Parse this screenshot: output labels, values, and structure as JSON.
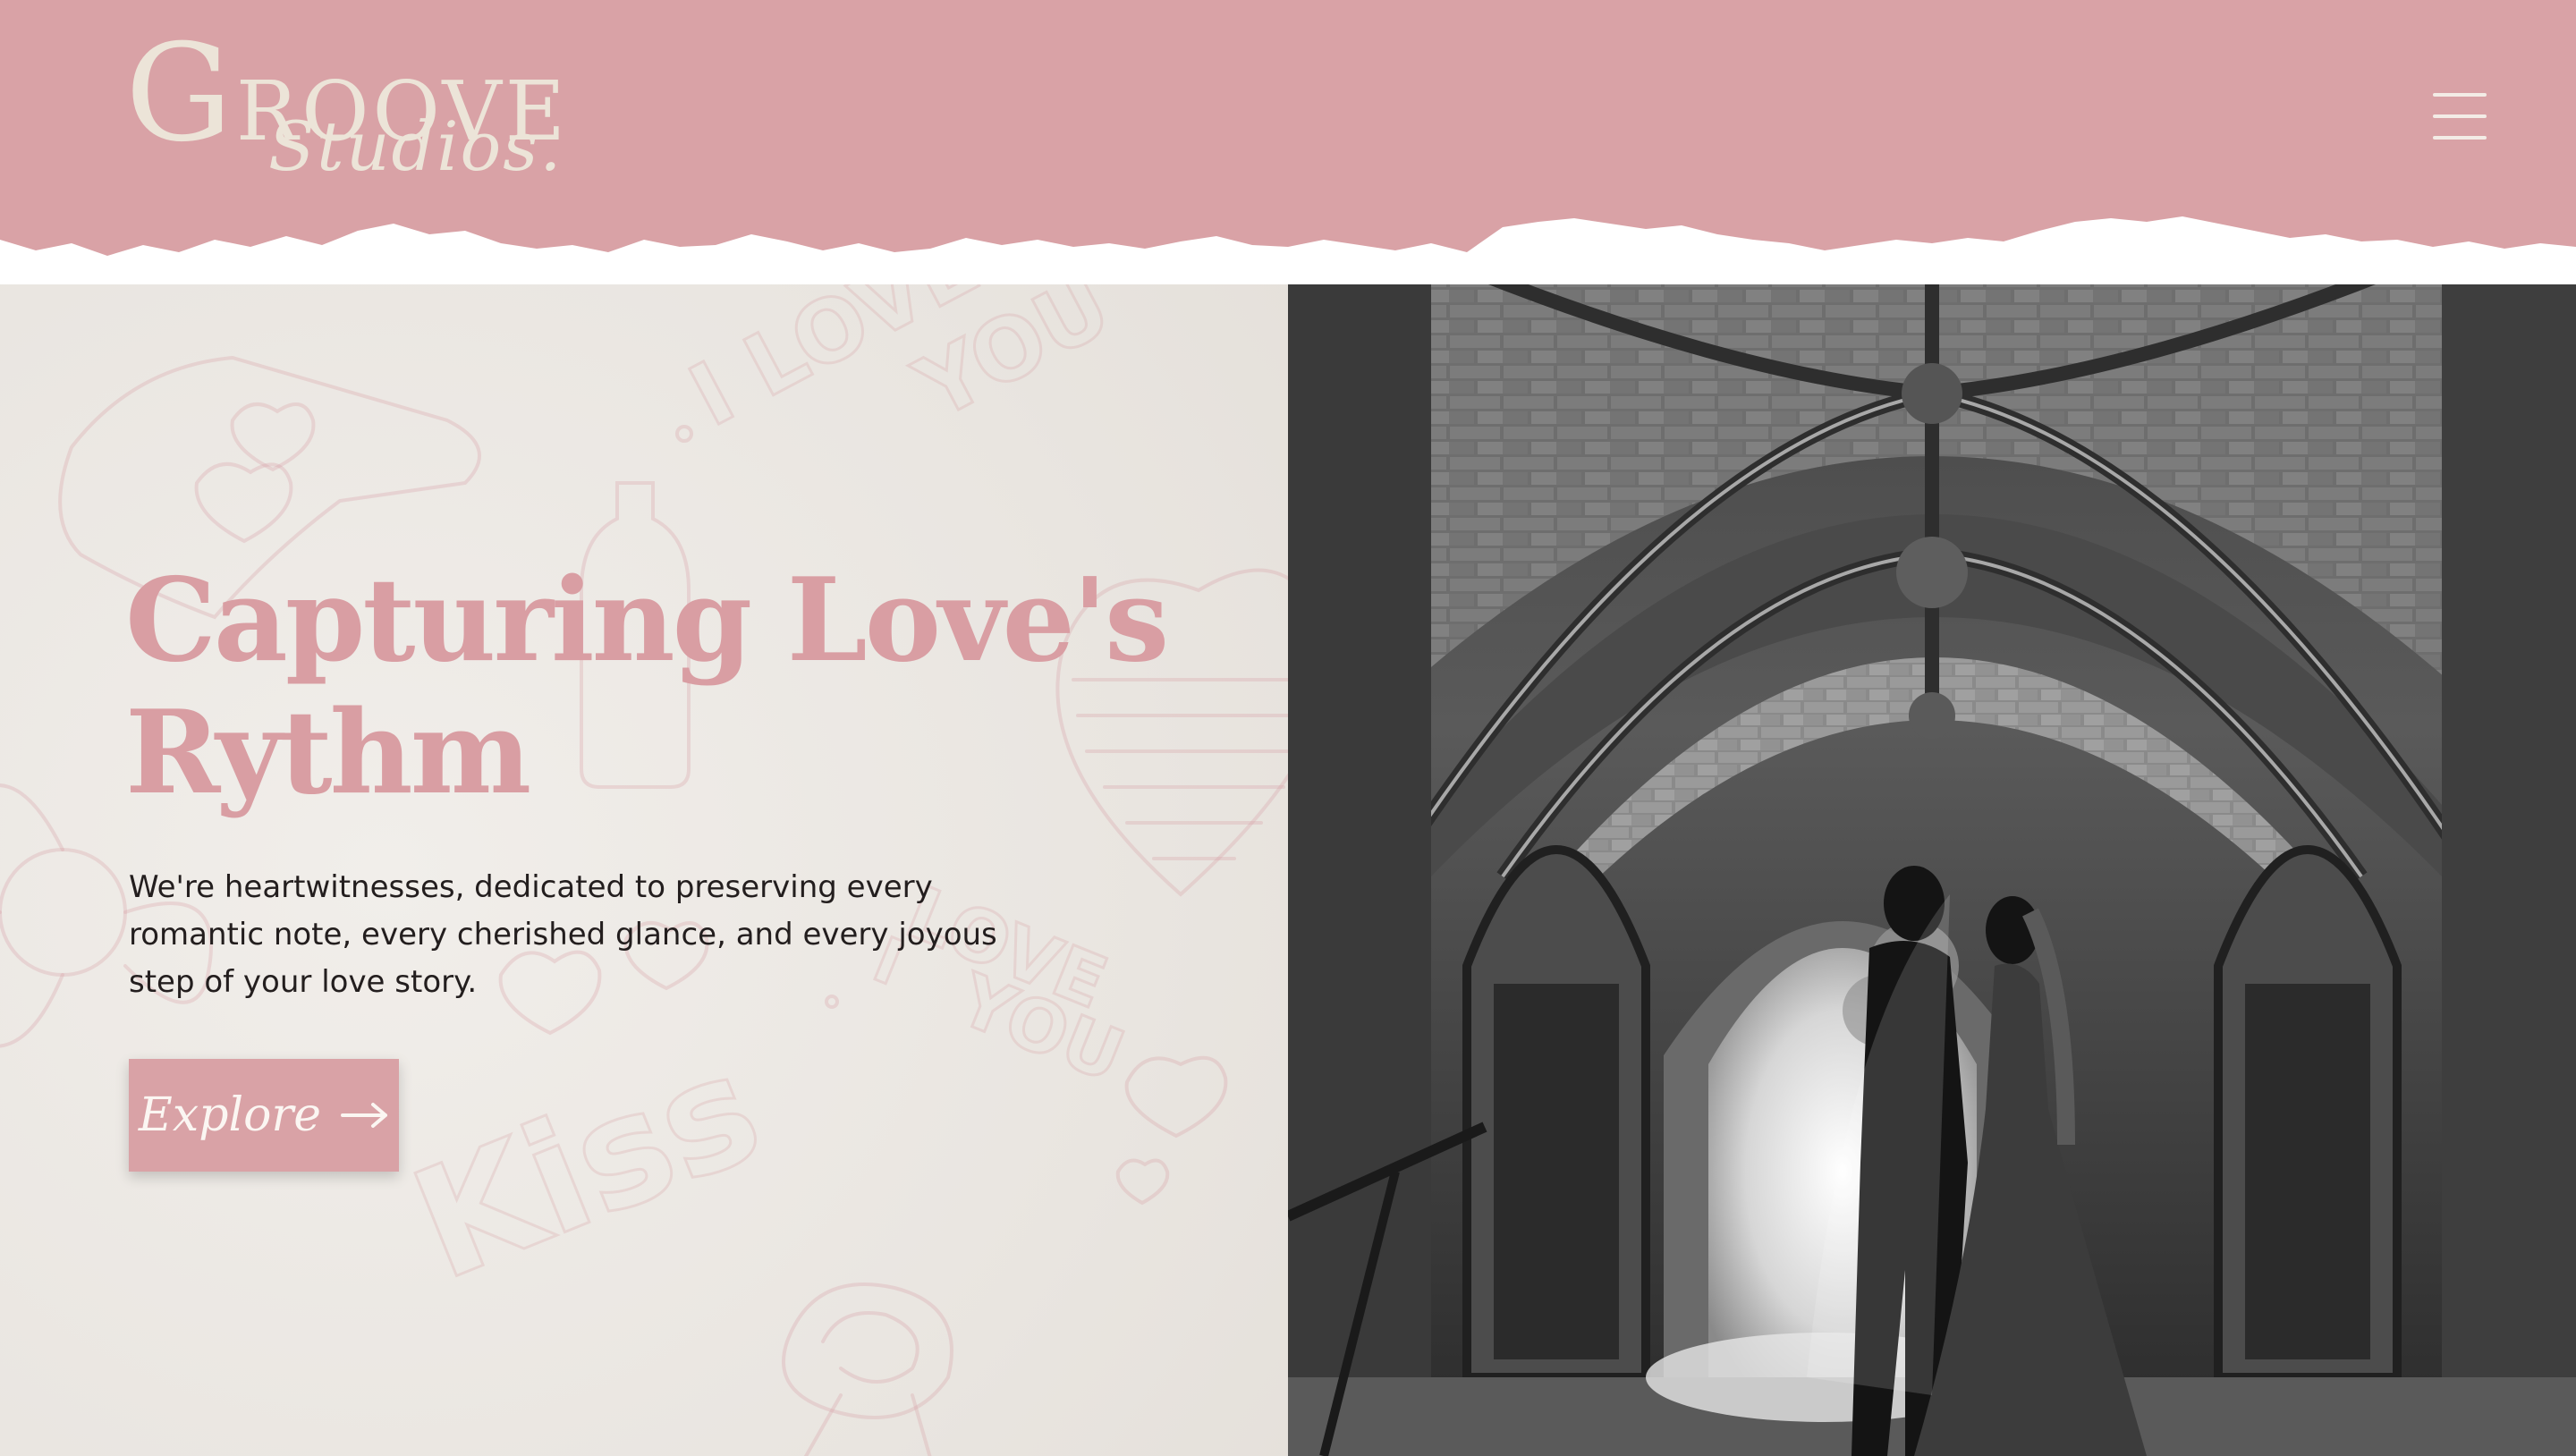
{
  "brand": {
    "logo_initial": "G",
    "logo_word": "ROOVE",
    "logo_sub": "Studios."
  },
  "hero": {
    "title_line1": "Capturing Love's",
    "title_line2": "Rythm",
    "subtitle": "We're heartwitnesses, dedicated to preserving every romantic note, every cherished glance, and every joyous step of your love story.",
    "cta_label": "Explore"
  },
  "icons": {
    "menu": "hamburger-menu-icon",
    "arrow": "arrow-right-icon"
  },
  "colors": {
    "brand_pink": "#d9a2a6",
    "title_pink": "#d99ea3",
    "cream": "#ece4d8",
    "paper": "#ebe7e2"
  }
}
